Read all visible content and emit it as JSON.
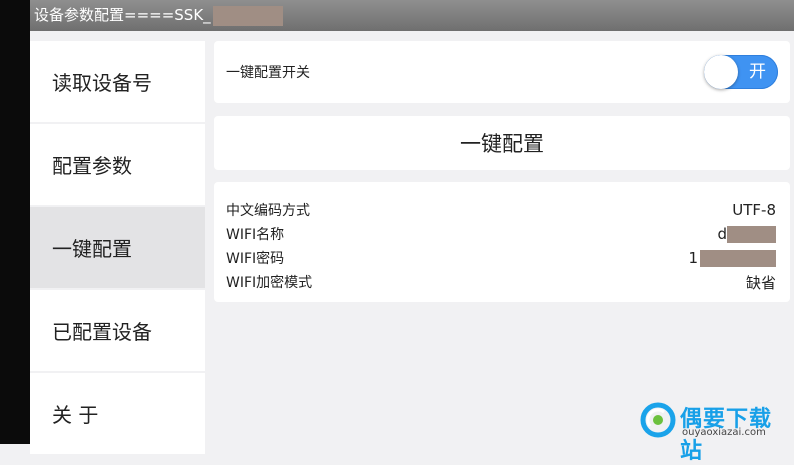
{
  "window": {
    "title": "设备参数配置====SSK_"
  },
  "sidebar": {
    "items": [
      {
        "label": "读取设备号"
      },
      {
        "label": "配置参数"
      },
      {
        "label": "一键配置"
      },
      {
        "label": "已配置设备"
      },
      {
        "label": "关 于"
      }
    ],
    "active_index": 2
  },
  "switch_panel": {
    "label": "一键配置开关",
    "toggle_state": "开"
  },
  "action": {
    "label": "一键配置"
  },
  "info": {
    "rows": [
      {
        "label": "中文编码方式",
        "value": "UTF-8"
      },
      {
        "label": "WIFI名称",
        "value": "d"
      },
      {
        "label": "WIFI密码",
        "value": "1"
      },
      {
        "label": "WIFI加密模式",
        "value": "缺省"
      }
    ]
  },
  "watermark": {
    "name": "偶要下载站",
    "url": "ouyaoxiazai.com"
  },
  "colors": {
    "accent": "#3f93f2",
    "titlebar": "#7d7d7d",
    "redaction": "#a08e84",
    "watermark": "#18a0e8"
  }
}
